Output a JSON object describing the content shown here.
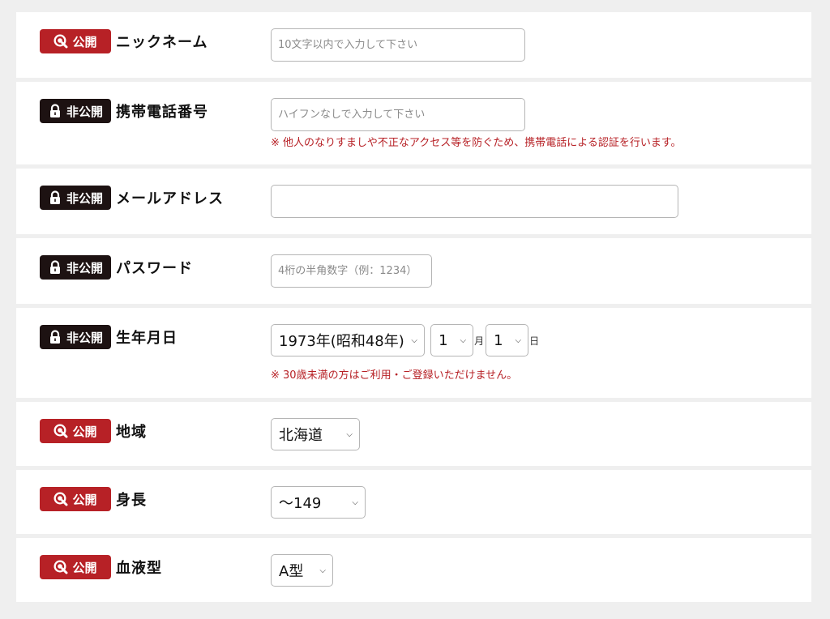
{
  "badges": {
    "public": "公開",
    "private": "非公開"
  },
  "nickname": {
    "label": "ニックネーム",
    "placeholder": "10文字以内で入力して下さい"
  },
  "mobile": {
    "label": "携帯電話番号",
    "placeholder": "ハイフンなしで入力して下さい",
    "note": "※ 他人のなりすましや不正なアクセス等を防ぐため、携帯電話による認証を行います。"
  },
  "email": {
    "label": "メールアドレス",
    "placeholder": ""
  },
  "password": {
    "label": "パスワード",
    "placeholder": "4桁の半角数字（例：1234）"
  },
  "birthday": {
    "label": "生年月日",
    "year": "1973年(昭和48年)",
    "month": "1",
    "month_unit": "月",
    "day": "1",
    "day_unit": "日",
    "note": "※ 30歳未満の方はご利用・ご登録いただけません。"
  },
  "region": {
    "label": "地域",
    "value": "北海道"
  },
  "height": {
    "label": "身長",
    "value": "〜149"
  },
  "blood": {
    "label": "血液型",
    "value": "A型"
  },
  "colors": {
    "public": "#b72126",
    "private": "#1d1212",
    "note": "#b72126"
  },
  "icons": {
    "public": "search-icon",
    "private": "lock-icon",
    "dropdown": "chevron-down-icon"
  }
}
